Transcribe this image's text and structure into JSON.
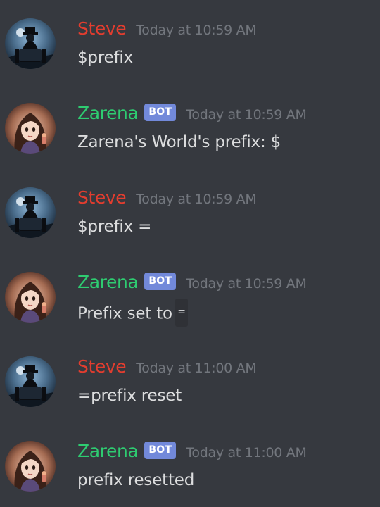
{
  "colors": {
    "background": "#36393f",
    "steve": "#e23d2f",
    "zarena": "#2ecc71",
    "bot_tag": "#7289da",
    "timestamp": "#72767d",
    "text": "#dcddde"
  },
  "messages": [
    {
      "author": "Steve",
      "author_role": "user",
      "bot_tag": "",
      "timestamp": "Today at 10:59 AM",
      "content": "$prefix",
      "code": "",
      "avatar_icon": "steve-avatar"
    },
    {
      "author": "Zarena",
      "author_role": "bot",
      "bot_tag": "BOT",
      "timestamp": "Today at 10:59 AM",
      "content": "Zarena's World's prefix: $",
      "code": "",
      "avatar_icon": "zarena-avatar"
    },
    {
      "author": "Steve",
      "author_role": "user",
      "bot_tag": "",
      "timestamp": "Today at 10:59 AM",
      "content": "$prefix =",
      "code": "",
      "avatar_icon": "steve-avatar"
    },
    {
      "author": "Zarena",
      "author_role": "bot",
      "bot_tag": "BOT",
      "timestamp": "Today at 10:59 AM",
      "content": "Prefix set to",
      "code": "=",
      "avatar_icon": "zarena-avatar"
    },
    {
      "author": "Steve",
      "author_role": "user",
      "bot_tag": "",
      "timestamp": "Today at 11:00 AM",
      "content": "=prefix reset",
      "code": "",
      "avatar_icon": "steve-avatar"
    },
    {
      "author": "Zarena",
      "author_role": "bot",
      "bot_tag": "BOT",
      "timestamp": "Today at 11:00 AM",
      "content": "prefix resetted",
      "code": "",
      "avatar_icon": "zarena-avatar"
    }
  ]
}
